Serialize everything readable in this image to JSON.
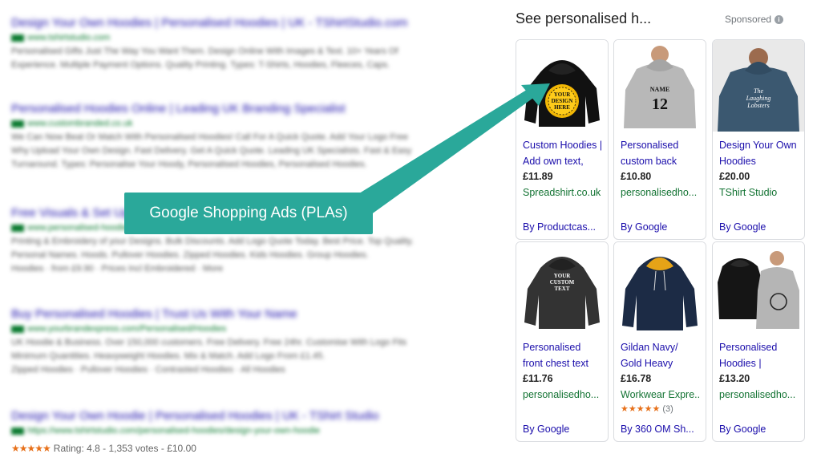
{
  "organic": [
    {
      "title": "Design Your Own Hoodies | Personalised Hoodies | UK - TShirtStudio.com",
      "url": "www.tshirtstudio.com",
      "snippet": [
        "Personalised Gifts Just The Way You Want Them. Design Online With Images & Text. 10+ Years Of",
        "Experience. Multiple Payment Options. Quality Printing. Types: T-Shirts, Hoodies, Fleeces, Caps."
      ]
    },
    {
      "title": "Personalised Hoodies Online | Leading UK Branding Specialist",
      "url": "www.custombranded.co.uk",
      "snippet": [
        "We Can Now Beat Or Match With Personalised Hoodies! Call For A Quick Quote. Add Your Logo Free",
        "Why Upload Your Own Design. Fast Delivery. Get A Quick Quote. Leading UK Specialists. Fast & Easy",
        "Turnaround. Types: Personalise Your Hoody, Personalised Hoodies, Personalised Hoodies."
      ]
    },
    {
      "title": "Free Visuals & Set Up",
      "url": "www.personalised-hoodies.co.uk",
      "snippet": [
        "Printing & Embroidery of your Designs. Bulk Discounts. Add Logo Quote Today. Best Price. Top Quality.",
        "Personal Names. Hoods. Pullover Hoodies. Zipped Hoodies. Kids Hoodies. Group Hoodies.",
        "Hoodies · from £9.90 · Prices Incl Embroidered · More"
      ]
    },
    {
      "title": "Buy Personalised Hoodies | Trust Us With Your Name",
      "url": "www.yourbrandexpress.com/Personalised/Hoodies",
      "snippet": [
        "UK Hoodie & Business. Over 150,000 customers. Free Delivery. Free 24hr. Customise With Logo Fits",
        "Minimum Quantities. Heavyweight Hoodies. Mix & Match. Add Logo From £1.45.",
        "Zipped Hoodies · Pullover Hoodies · Contrasted Hoodies · All Hoodies"
      ]
    },
    {
      "title": "Design Your Own Hoodie | Personalised Hoodies | UK - TShirt Studio",
      "url": "https://www.tshirtstudio.com/personalised-hoodies/design-your-own-hoodie",
      "snippet": []
    }
  ],
  "rating_line": {
    "stars": "★★★★★",
    "text": "Rating: 4.8 - 1,353 votes - £10.00"
  },
  "panel": {
    "title": "See personalised h...",
    "sponsored": "Sponsored",
    "info_icon": "i"
  },
  "products": [
    {
      "title": "Custom Hoodies | Add own text,",
      "price": "£11.89",
      "store": "Spreadshirt.co.uk",
      "by": "By Productcas...",
      "image": "black hoodie with YOUR DESIGN HERE badge"
    },
    {
      "title": "Personalised custom back",
      "price": "£10.80",
      "store": "personalisedho...",
      "by": "By Google",
      "image": "grey hoodie NAME 12 back"
    },
    {
      "title": "Design Your Own Hoodies",
      "price": "£20.00",
      "store": "TShirt Studio",
      "by": "By Google",
      "image": "navy hoodie The Laughing Lobsters"
    },
    {
      "title": "Personalised front chest text",
      "price": "£11.76",
      "store": "personalisedho...",
      "by": "By Google",
      "image": "black hoodie YOUR CUSTOM TEXT"
    },
    {
      "title": "Gildan Navy/ Gold Heavy",
      "price": "£16.78",
      "store": "Workwear Expre..",
      "stars": "★★★★★",
      "reviews": "(3)",
      "by": "By 360 OM Sh...",
      "image": "navy hoodie gold hood"
    },
    {
      "title": "Personalised Hoodies |",
      "price": "£13.20",
      "store": "personalisedho...",
      "by": "By Google",
      "image": "black and grey hoodies"
    }
  ],
  "annotation": {
    "label": "Google Shopping Ads (PLAs)"
  },
  "image_text": {
    "p1": [
      "YOUR",
      "DESIGN",
      "HERE"
    ],
    "p2": [
      "NAME",
      "12"
    ],
    "p3": [
      "The",
      "Laughing",
      "Lobsters"
    ],
    "p4": [
      "YOUR",
      "CUSTOM",
      "TEXT"
    ]
  },
  "colors": {
    "link": "#1a0dab",
    "store": "#137333",
    "accent": "#2aa89a",
    "star": "#e7711b"
  }
}
